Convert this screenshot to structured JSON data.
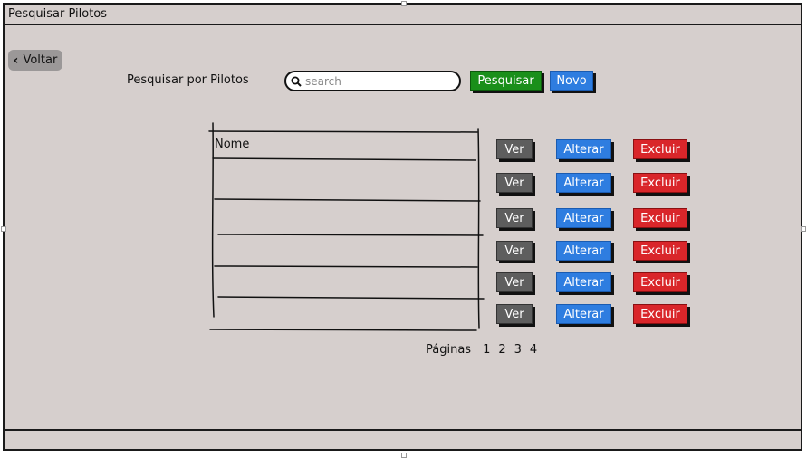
{
  "window": {
    "title": "Pesquisar Pilotos"
  },
  "nav": {
    "back_label": "Voltar"
  },
  "search": {
    "label": "Pesquisar por Pilotos",
    "placeholder": "search",
    "submit_label": "Pesquisar",
    "new_label": "Novo"
  },
  "table": {
    "columns": [
      "Nome"
    ],
    "rows": [
      {
        "actions": [
          "Ver",
          "Alterar",
          "Excluir"
        ]
      },
      {
        "actions": [
          "Ver",
          "Alterar",
          "Excluir"
        ]
      },
      {
        "actions": [
          "Ver",
          "Alterar",
          "Excluir"
        ]
      },
      {
        "actions": [
          "Ver",
          "Alterar",
          "Excluir"
        ]
      },
      {
        "actions": [
          "Ver",
          "Alterar",
          "Excluir"
        ]
      },
      {
        "actions": [
          "Ver",
          "Alterar",
          "Excluir"
        ]
      }
    ]
  },
  "pagination": {
    "label": "Páginas",
    "pages": [
      "1",
      "2",
      "3",
      "4"
    ]
  },
  "colors": {
    "background": "#d6cfcd",
    "search_button": "#1a8f1a",
    "new_button": "#2e7de0",
    "view_button": "#5e5e5e",
    "edit_button": "#2e7de0",
    "delete_button": "#d9262a"
  }
}
